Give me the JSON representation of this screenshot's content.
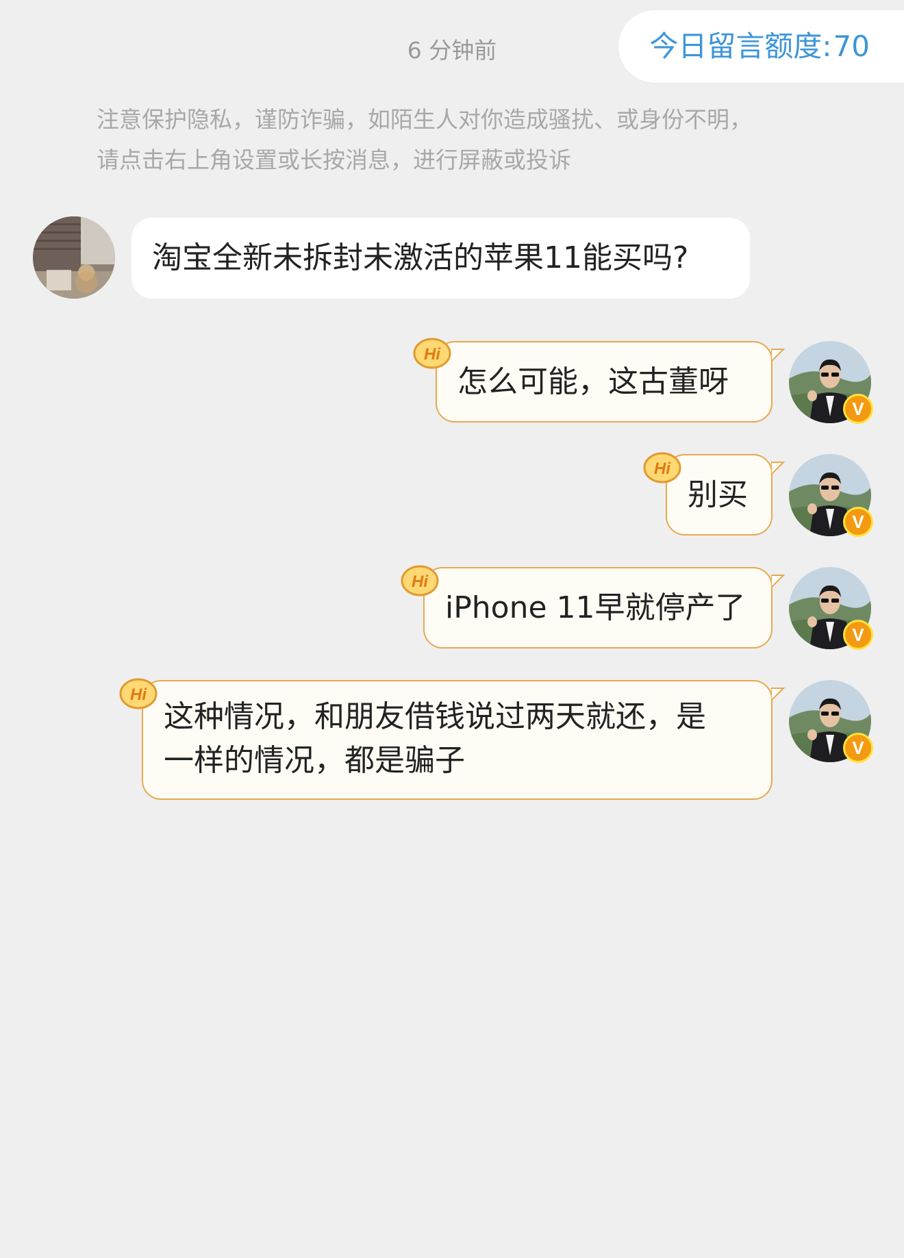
{
  "header": {
    "timestamp": "6 分钟前",
    "quota_label": "今日留言额度:",
    "quota_value": "70"
  },
  "notice": {
    "line1": "注意保护隐私，谨防诈骗，如陌生人对你造成骚扰、或身份不明，",
    "line2": "请点击右上角设置或长按消息，进行屏蔽或投诉"
  },
  "messages": [
    {
      "direction": "incoming",
      "text": "淘宝全新未拆封未激活的苹果11能买吗?"
    },
    {
      "direction": "outgoing",
      "text": "怎么可能，这古董呀",
      "badge": "Hi"
    },
    {
      "direction": "outgoing",
      "text": "别买",
      "badge": "Hi"
    },
    {
      "direction": "outgoing",
      "text": "iPhone 11早就停产了",
      "badge": "Hi"
    },
    {
      "direction": "outgoing",
      "lines": [
        "这种情况，和朋友借钱说过两天就还，是",
        "一样的情况，都是骗子"
      ],
      "badge": "Hi"
    }
  ],
  "verified_badge": "V",
  "colors": {
    "background": "#efefef",
    "quota_text": "#3e95d8",
    "outgoing_border": "#e6a84f",
    "outgoing_fill": "#fffcf5",
    "verified_badge": "#f39a12"
  }
}
